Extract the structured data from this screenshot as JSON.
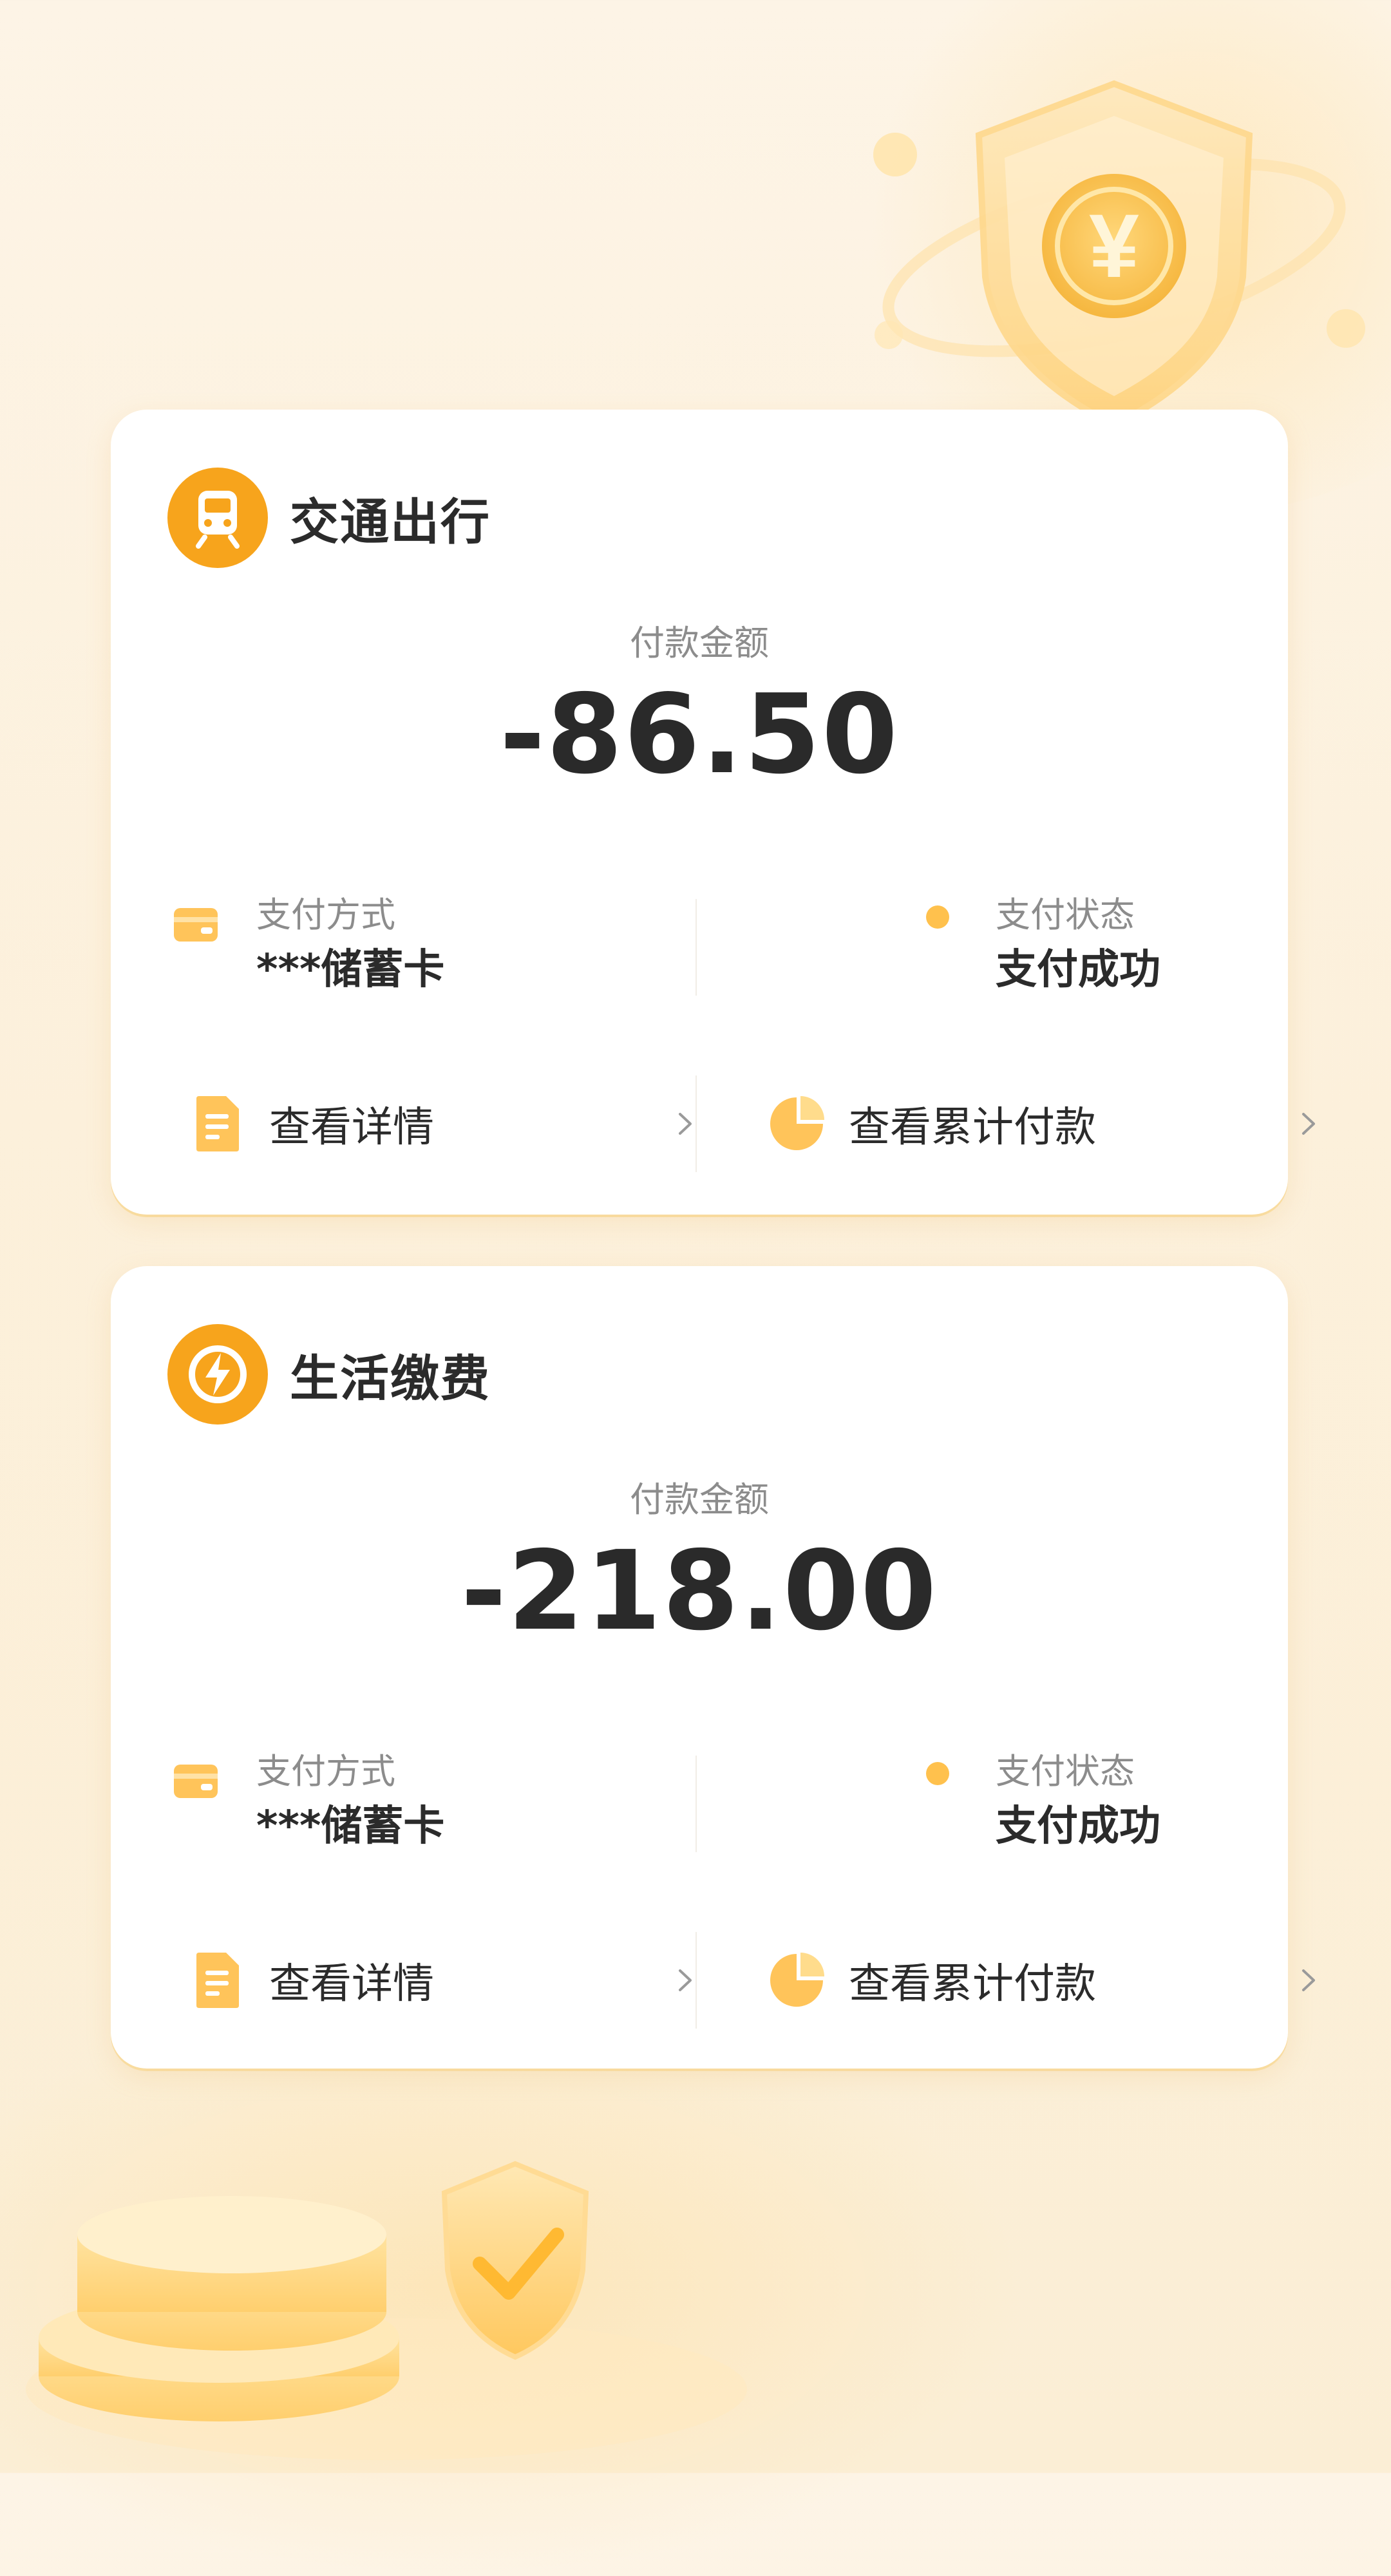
{
  "colors": {
    "accent": "#f7a41c",
    "accent_light": "#ffcc66",
    "text_primary": "#2b2b2b",
    "text_secondary": "#8c8c8c",
    "background": "#fdf4e6"
  },
  "decorations": {
    "top": "shield-yuan-icon",
    "bottom": "coins-shield-check-icon"
  },
  "cards": [
    {
      "category_icon": "train-icon",
      "category_title": "交通出行",
      "amount_label": "付款金额",
      "amount_value": "-86.50",
      "payment_method": {
        "icon": "card-icon",
        "label": "支付方式",
        "value": "***储蓄卡"
      },
      "payment_status": {
        "icon": "status-dot-icon",
        "label": "支付状态",
        "value": "支付成功"
      },
      "actions": [
        {
          "icon": "document-icon",
          "label": "查看详情"
        },
        {
          "icon": "pie-chart-icon",
          "label": "查看累计付款"
        }
      ]
    },
    {
      "category_icon": "lightning-icon",
      "category_title": "生活缴费",
      "amount_label": "付款金额",
      "amount_value": "-218.00",
      "payment_method": {
        "icon": "card-icon",
        "label": "支付方式",
        "value": "***储蓄卡"
      },
      "payment_status": {
        "icon": "status-dot-icon",
        "label": "支付状态",
        "value": "支付成功"
      },
      "actions": [
        {
          "icon": "document-icon",
          "label": "查看详情"
        },
        {
          "icon": "pie-chart-icon",
          "label": "查看累计付款"
        }
      ]
    }
  ]
}
